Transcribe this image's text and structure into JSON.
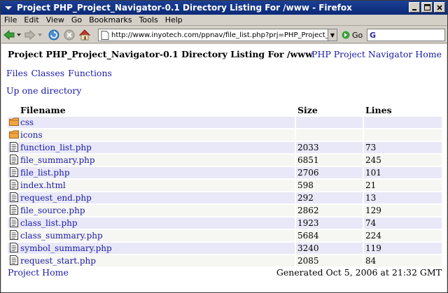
{
  "window": {
    "title": "Project PHP_Project_Navigator-0.1 Directory Listing For /www - Firefox"
  },
  "menu": [
    "File",
    "Edit",
    "View",
    "Go",
    "Bookmarks",
    "Tools",
    "Help"
  ],
  "toolbar": {
    "url": "http://www.inyotech.com/ppnav/file_list.php?prj=PHP_Project_Navigator",
    "go_label": "Go",
    "search_value": ""
  },
  "page": {
    "heading": "Project PHP_Project_Navigator-0.1 Directory Listing For /www",
    "home_link": "PHP Project Navigator Home",
    "nav": [
      "Files",
      "Classes",
      "Functions"
    ],
    "up_link": "Up one directory",
    "columns": [
      "Filename",
      "Size",
      "Lines"
    ],
    "rows": [
      {
        "name": "css",
        "type": "folder",
        "size": "",
        "lines": ""
      },
      {
        "name": "icons",
        "type": "folder",
        "size": "",
        "lines": ""
      },
      {
        "name": "function_list.php",
        "type": "file",
        "size": "2033",
        "lines": "73"
      },
      {
        "name": "file_summary.php",
        "type": "file",
        "size": "6851",
        "lines": "245"
      },
      {
        "name": "file_list.php",
        "type": "file",
        "size": "2706",
        "lines": "101"
      },
      {
        "name": "index.html",
        "type": "file",
        "size": "598",
        "lines": "21"
      },
      {
        "name": "request_end.php",
        "type": "file",
        "size": "292",
        "lines": "13"
      },
      {
        "name": "file_source.php",
        "type": "file",
        "size": "2862",
        "lines": "129"
      },
      {
        "name": "class_list.php",
        "type": "file",
        "size": "1923",
        "lines": "74"
      },
      {
        "name": "class_summary.php",
        "type": "file",
        "size": "5684",
        "lines": "224"
      },
      {
        "name": "symbol_summary.php",
        "type": "file",
        "size": "3240",
        "lines": "119"
      },
      {
        "name": "request_start.php",
        "type": "file",
        "size": "2085",
        "lines": "84"
      }
    ],
    "footer_link": "Project Home",
    "generated": "Generated Oct 5, 2006 at 21:32 GMT"
  },
  "colors": {
    "link": "#1a1aa6",
    "titlebar": "#0b2a78",
    "row_tint": "#e8e8f8"
  }
}
